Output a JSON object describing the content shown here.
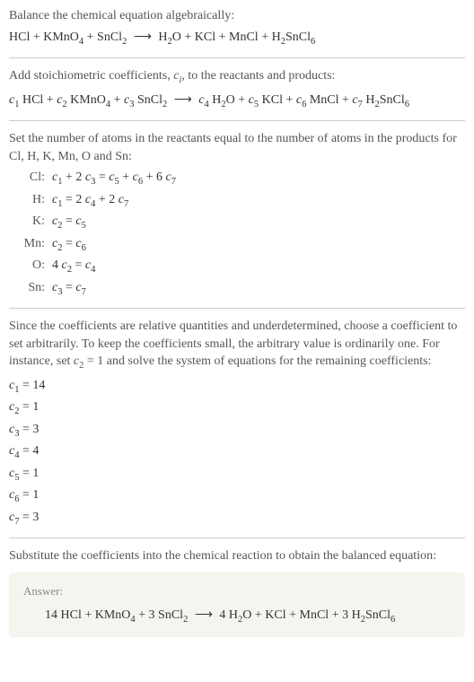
{
  "intro": {
    "line1": "Balance the chemical equation algebraically:",
    "equation": "HCl + KMnO₄ + SnCl₂ ⟶ H₂O + KCl + MnCl + H₂SnCl₆"
  },
  "step1": {
    "text": "Add stoichiometric coefficients, cᵢ, to the reactants and products:",
    "equation": "c₁ HCl + c₂ KMnO₄ + c₃ SnCl₂ ⟶ c₄ H₂O + c₅ KCl + c₆ MnCl + c₇ H₂SnCl₆"
  },
  "step2": {
    "text": "Set the number of atoms in the reactants equal to the number of atoms in the products for Cl, H, K, Mn, O and Sn:",
    "atoms": [
      {
        "label": "Cl:",
        "eq": "c₁ + 2 c₃ = c₅ + c₆ + 6 c₇"
      },
      {
        "label": "H:",
        "eq": "c₁ = 2 c₄ + 2 c₇"
      },
      {
        "label": "K:",
        "eq": "c₂ = c₅"
      },
      {
        "label": "Mn:",
        "eq": "c₂ = c₆"
      },
      {
        "label": "O:",
        "eq": "4 c₂ = c₄"
      },
      {
        "label": "Sn:",
        "eq": "c₃ = c₇"
      }
    ]
  },
  "step3": {
    "text": "Since the coefficients are relative quantities and underdetermined, choose a coefficient to set arbitrarily. To keep the coefficients small, the arbitrary value is ordinarily one. For instance, set c₂ = 1 and solve the system of equations for the remaining coefficients:",
    "coefs": [
      "c₁ = 14",
      "c₂ = 1",
      "c₃ = 3",
      "c₄ = 4",
      "c₅ = 1",
      "c₆ = 1",
      "c₇ = 3"
    ]
  },
  "step4": {
    "text": "Substitute the coefficients into the chemical reaction to obtain the balanced equation:"
  },
  "answer": {
    "label": "Answer:",
    "equation": "14 HCl + KMnO₄ + 3 SnCl₂ ⟶ 4 H₂O + KCl + MnCl + 3 H₂SnCl₆"
  }
}
